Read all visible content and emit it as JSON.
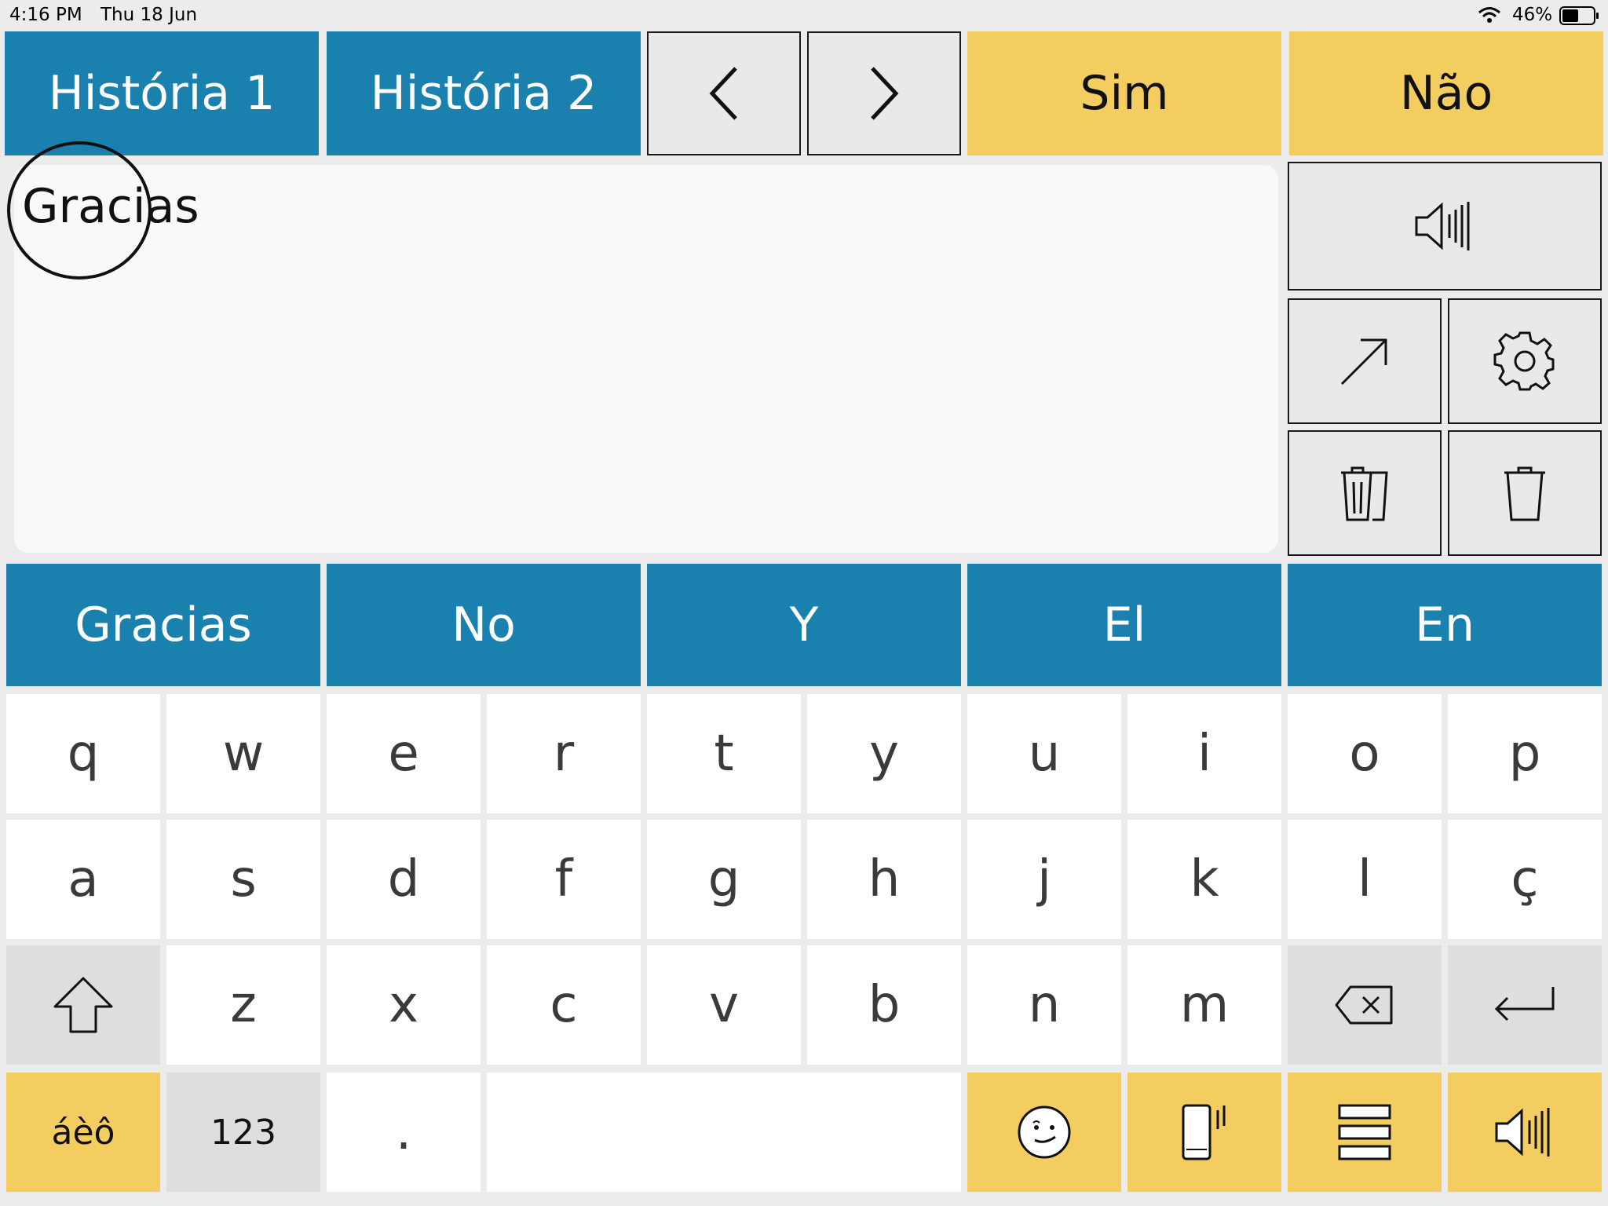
{
  "status_bar": {
    "time": "4:16 PM",
    "date": "Thu 18 Jun",
    "battery": "46%"
  },
  "top_bar": {
    "story1": "História 1",
    "story2": "História 2",
    "yes": "Sim",
    "no": "Não"
  },
  "message": {
    "text": "Gracias"
  },
  "predictions": [
    "Gracias",
    "No",
    "Y",
    "El",
    "En"
  ],
  "keyboard": {
    "row1": [
      "q",
      "w",
      "e",
      "r",
      "t",
      "y",
      "u",
      "i",
      "o",
      "p"
    ],
    "row2": [
      "a",
      "s",
      "d",
      "f",
      "g",
      "h",
      "j",
      "k",
      "l",
      "ç"
    ],
    "row3": [
      "z",
      "x",
      "c",
      "v",
      "b",
      "n",
      "m"
    ],
    "accents": "áèô",
    "numbers": "123",
    "period": "."
  },
  "colors": {
    "blue": "#1a80ad",
    "yellow": "#f4cd61",
    "gray_key": "#e9e9e9",
    "background": "#ececec"
  },
  "icons": {
    "back": "chevron-left-icon",
    "forward": "chevron-right-icon",
    "speak": "speaker-icon",
    "share": "arrow-up-right-icon",
    "settings": "gear-icon",
    "clear_all": "double-trash-icon",
    "clear": "trash-icon",
    "shift": "shift-arrow-icon",
    "backspace": "backspace-icon",
    "enter": "return-icon",
    "emoji": "smiley-icon",
    "phone": "phone-vibrate-icon",
    "menu": "rows-icon"
  }
}
